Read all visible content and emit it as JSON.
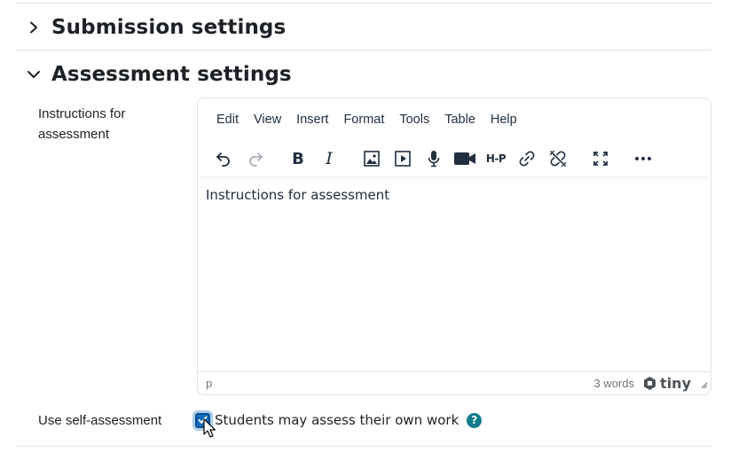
{
  "sections": [
    {
      "title": "Submission settings",
      "expanded": false
    },
    {
      "title": "Assessment settings",
      "expanded": true
    }
  ],
  "instructions_field": {
    "label_line1": "Instructions for",
    "label_line2": "assessment"
  },
  "editor": {
    "menu": [
      "Edit",
      "View",
      "Insert",
      "Format",
      "Tools",
      "Table",
      "Help"
    ],
    "toolbar_icons": [
      "undo-icon",
      "redo-icon",
      "bold-icon",
      "italic-icon",
      "image-icon",
      "media-icon",
      "record-audio-icon",
      "record-video-icon",
      "h5p-icon",
      "link-icon",
      "unlink-icon",
      "fullscreen-icon",
      "more-icon"
    ],
    "toolbar_text": {
      "bold": "B",
      "italic": "I",
      "h5p": "H-P"
    },
    "content": "Instructions for assessment",
    "path": "p",
    "word_count": "3 words",
    "brand": "tiny"
  },
  "self_assessment": {
    "label": "Use self-assessment",
    "checkbox_label": "Students may assess their own work",
    "checked": true,
    "help": "?"
  },
  "colors": {
    "accent": "#0f6cbf",
    "help": "#0f7c8c",
    "text": "#1d2125",
    "border": "#dee2e6"
  }
}
